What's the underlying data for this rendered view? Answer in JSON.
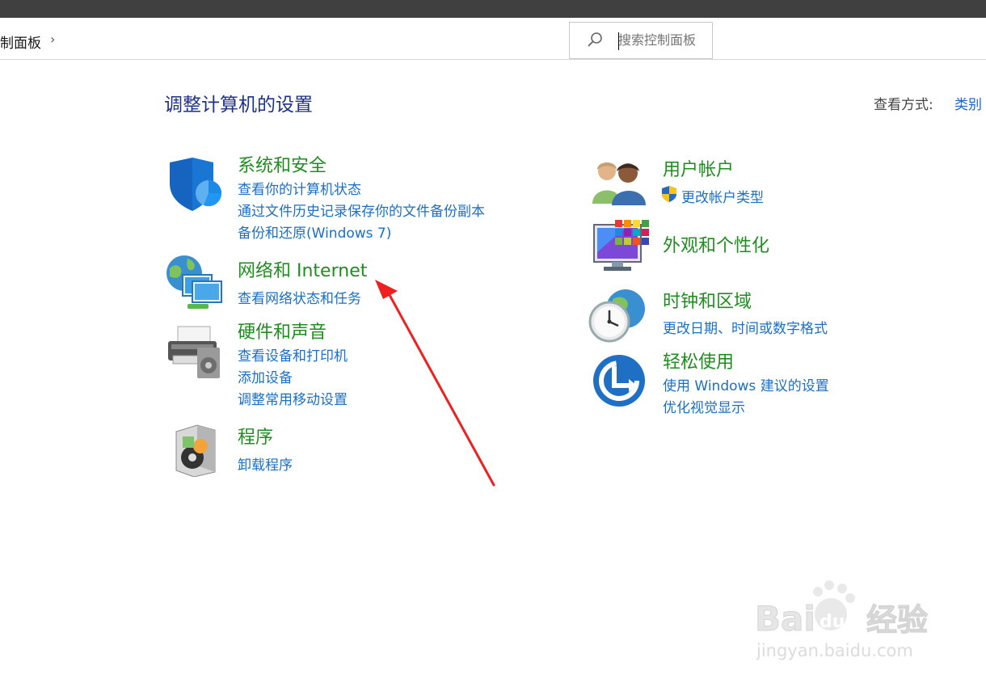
{
  "breadcrumb": {
    "item": "制面板"
  },
  "search": {
    "placeholder": "搜索控制面板"
  },
  "page": {
    "title": "调整计算机的设置",
    "view_by_label": "查看方式:",
    "view_by_value": "类别"
  },
  "categories": {
    "system_security": {
      "title": "系统和安全",
      "links": [
        "查看你的计算机状态",
        "通过文件历史记录保存你的文件备份副本",
        "备份和还原(Windows 7)"
      ]
    },
    "network": {
      "title": "网络和 Internet",
      "links": [
        "查看网络状态和任务"
      ]
    },
    "hardware": {
      "title": "硬件和声音",
      "links": [
        "查看设备和打印机",
        "添加设备",
        "调整常用移动设置"
      ]
    },
    "programs": {
      "title": "程序",
      "links": [
        "卸载程序"
      ]
    },
    "user_accounts": {
      "title": "用户帐户",
      "links": [
        "更改帐户类型"
      ]
    },
    "appearance": {
      "title": "外观和个性化",
      "links": []
    },
    "clock_region": {
      "title": "时钟和区域",
      "links": [
        "更改日期、时间或数字格式"
      ]
    },
    "ease_of_access": {
      "title": "轻松使用",
      "links": [
        "使用 Windows 建议的设置",
        "优化视觉显示"
      ]
    }
  },
  "watermark": {
    "logo": "Baidu经验",
    "url": "jingyan.baidu.com"
  },
  "annotation": {
    "arrow_color": "#f02020"
  }
}
